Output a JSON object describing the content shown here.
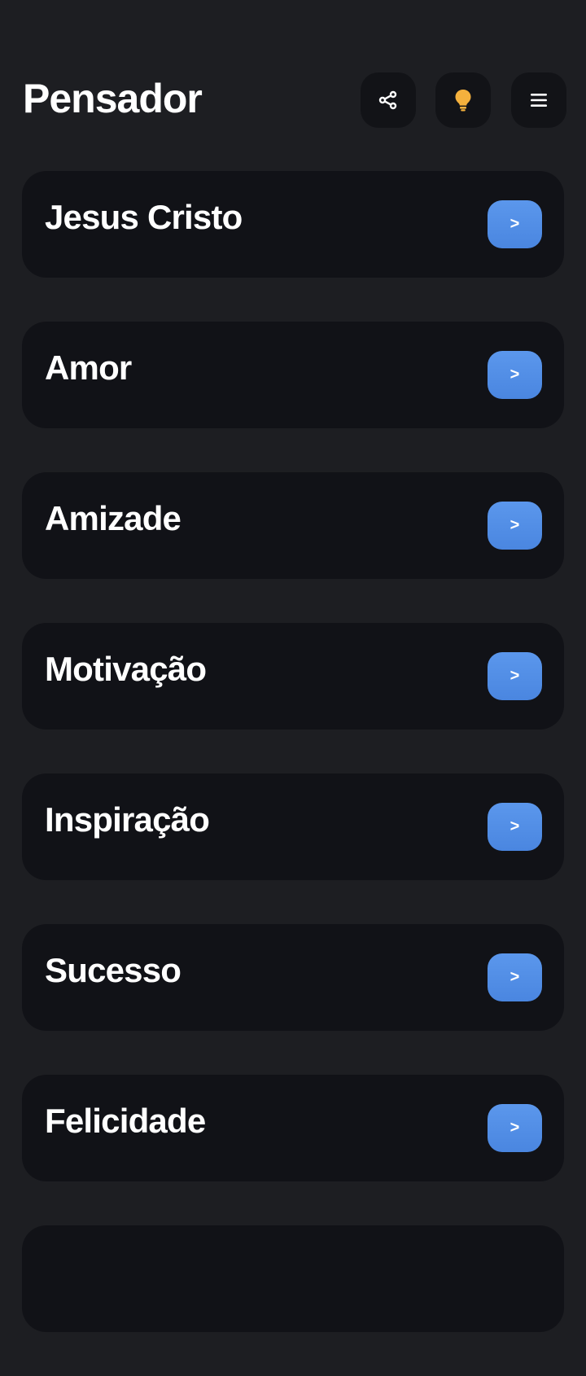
{
  "header": {
    "title": "Pensador",
    "buttons": [
      {
        "icon": "share-icon"
      },
      {
        "icon": "lightbulb-icon",
        "color": "#f5b13d"
      },
      {
        "icon": "hamburger-menu-icon"
      }
    ]
  },
  "categories": [
    {
      "label": "Jesus Cristo",
      "button": ">"
    },
    {
      "label": "Amor",
      "button": ">"
    },
    {
      "label": "Amizade",
      "button": ">"
    },
    {
      "label": "Motivação",
      "button": ">"
    },
    {
      "label": "Inspiração",
      "button": ">"
    },
    {
      "label": "Sucesso",
      "button": ">"
    },
    {
      "label": "Felicidade",
      "button": ">"
    },
    {
      "label": "",
      "button": ""
    }
  ],
  "colors": {
    "background": "#1d1e22",
    "card": "#111217",
    "accent": "#4f8be4",
    "bulb": "#f5b13d"
  }
}
